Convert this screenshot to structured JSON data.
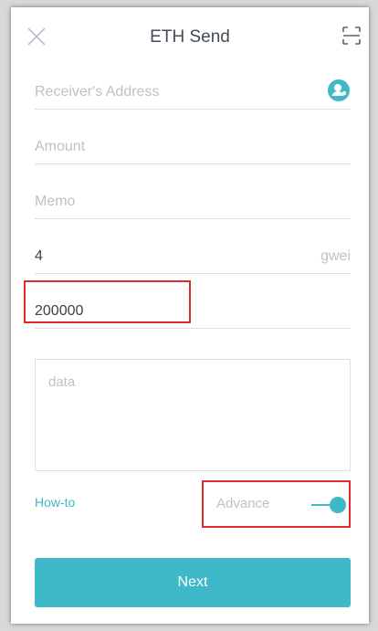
{
  "header": {
    "title": "ETH Send",
    "close_icon": "close-icon",
    "scan_icon": "scan-icon"
  },
  "form": {
    "receiver_address": {
      "placeholder": "Receiver's Address",
      "value": "",
      "icon": "contact-icon"
    },
    "amount": {
      "placeholder": "Amount",
      "value": ""
    },
    "memo": {
      "placeholder": "Memo",
      "value": ""
    },
    "gas_price": {
      "value": "4",
      "unit": "gwei"
    },
    "gas_limit": {
      "value": "200000"
    },
    "data": {
      "placeholder": "data",
      "value": ""
    }
  },
  "footer": {
    "how_to_label": "How-to",
    "advance_label": "Advance",
    "advance_enabled": true,
    "next_label": "Next"
  },
  "colors": {
    "accent": "#3fb8c8",
    "highlight": "#e02b2b",
    "placeholder": "#bcc2c8",
    "title": "#444c55"
  }
}
